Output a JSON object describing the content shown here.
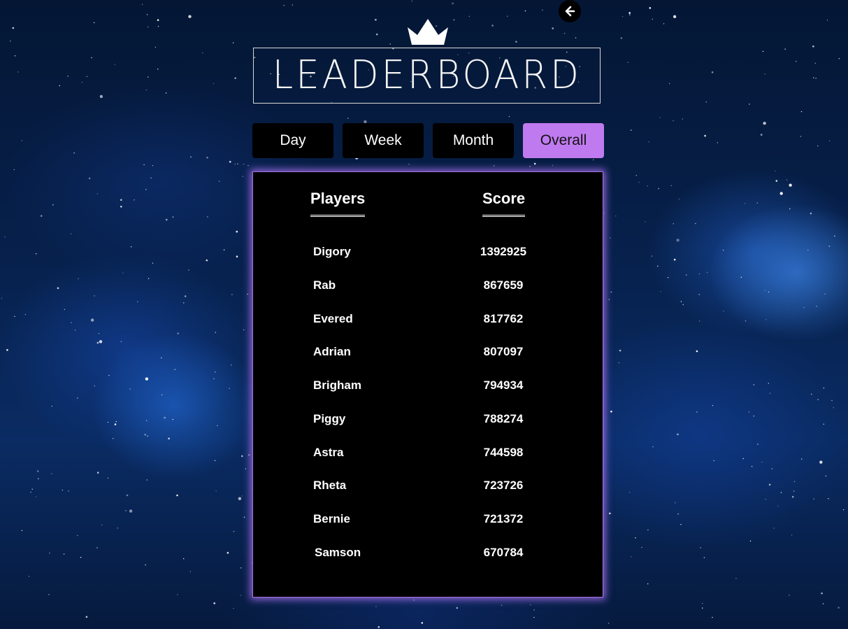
{
  "header": {
    "title": "LEADERBOARD",
    "crown_icon": "crown-icon",
    "back_icon": "arrow-left-icon"
  },
  "tabs": [
    {
      "label": "Day",
      "active": false
    },
    {
      "label": "Week",
      "active": false
    },
    {
      "label": "Month",
      "active": false
    },
    {
      "label": "Overall",
      "active": true
    }
  ],
  "table": {
    "columns": [
      "Players",
      "Score"
    ],
    "rows": [
      {
        "player": "Digory",
        "score": "1392925"
      },
      {
        "player": "Rab",
        "score": "867659"
      },
      {
        "player": "Evered",
        "score": "817762"
      },
      {
        "player": "Adrian",
        "score": "807097"
      },
      {
        "player": "Brigham",
        "score": "794934"
      },
      {
        "player": "Piggy",
        "score": "788274"
      },
      {
        "player": "Astra",
        "score": "744598"
      },
      {
        "player": "Rheta",
        "score": "723726"
      },
      {
        "player": "Bernie",
        "score": "721372"
      },
      {
        "player": "Samson",
        "score": "670784"
      }
    ]
  },
  "colors": {
    "accent": "#c07af0",
    "board_glow": "#b978ff",
    "board_bg": "#000000",
    "space_bg": "#07224f"
  }
}
